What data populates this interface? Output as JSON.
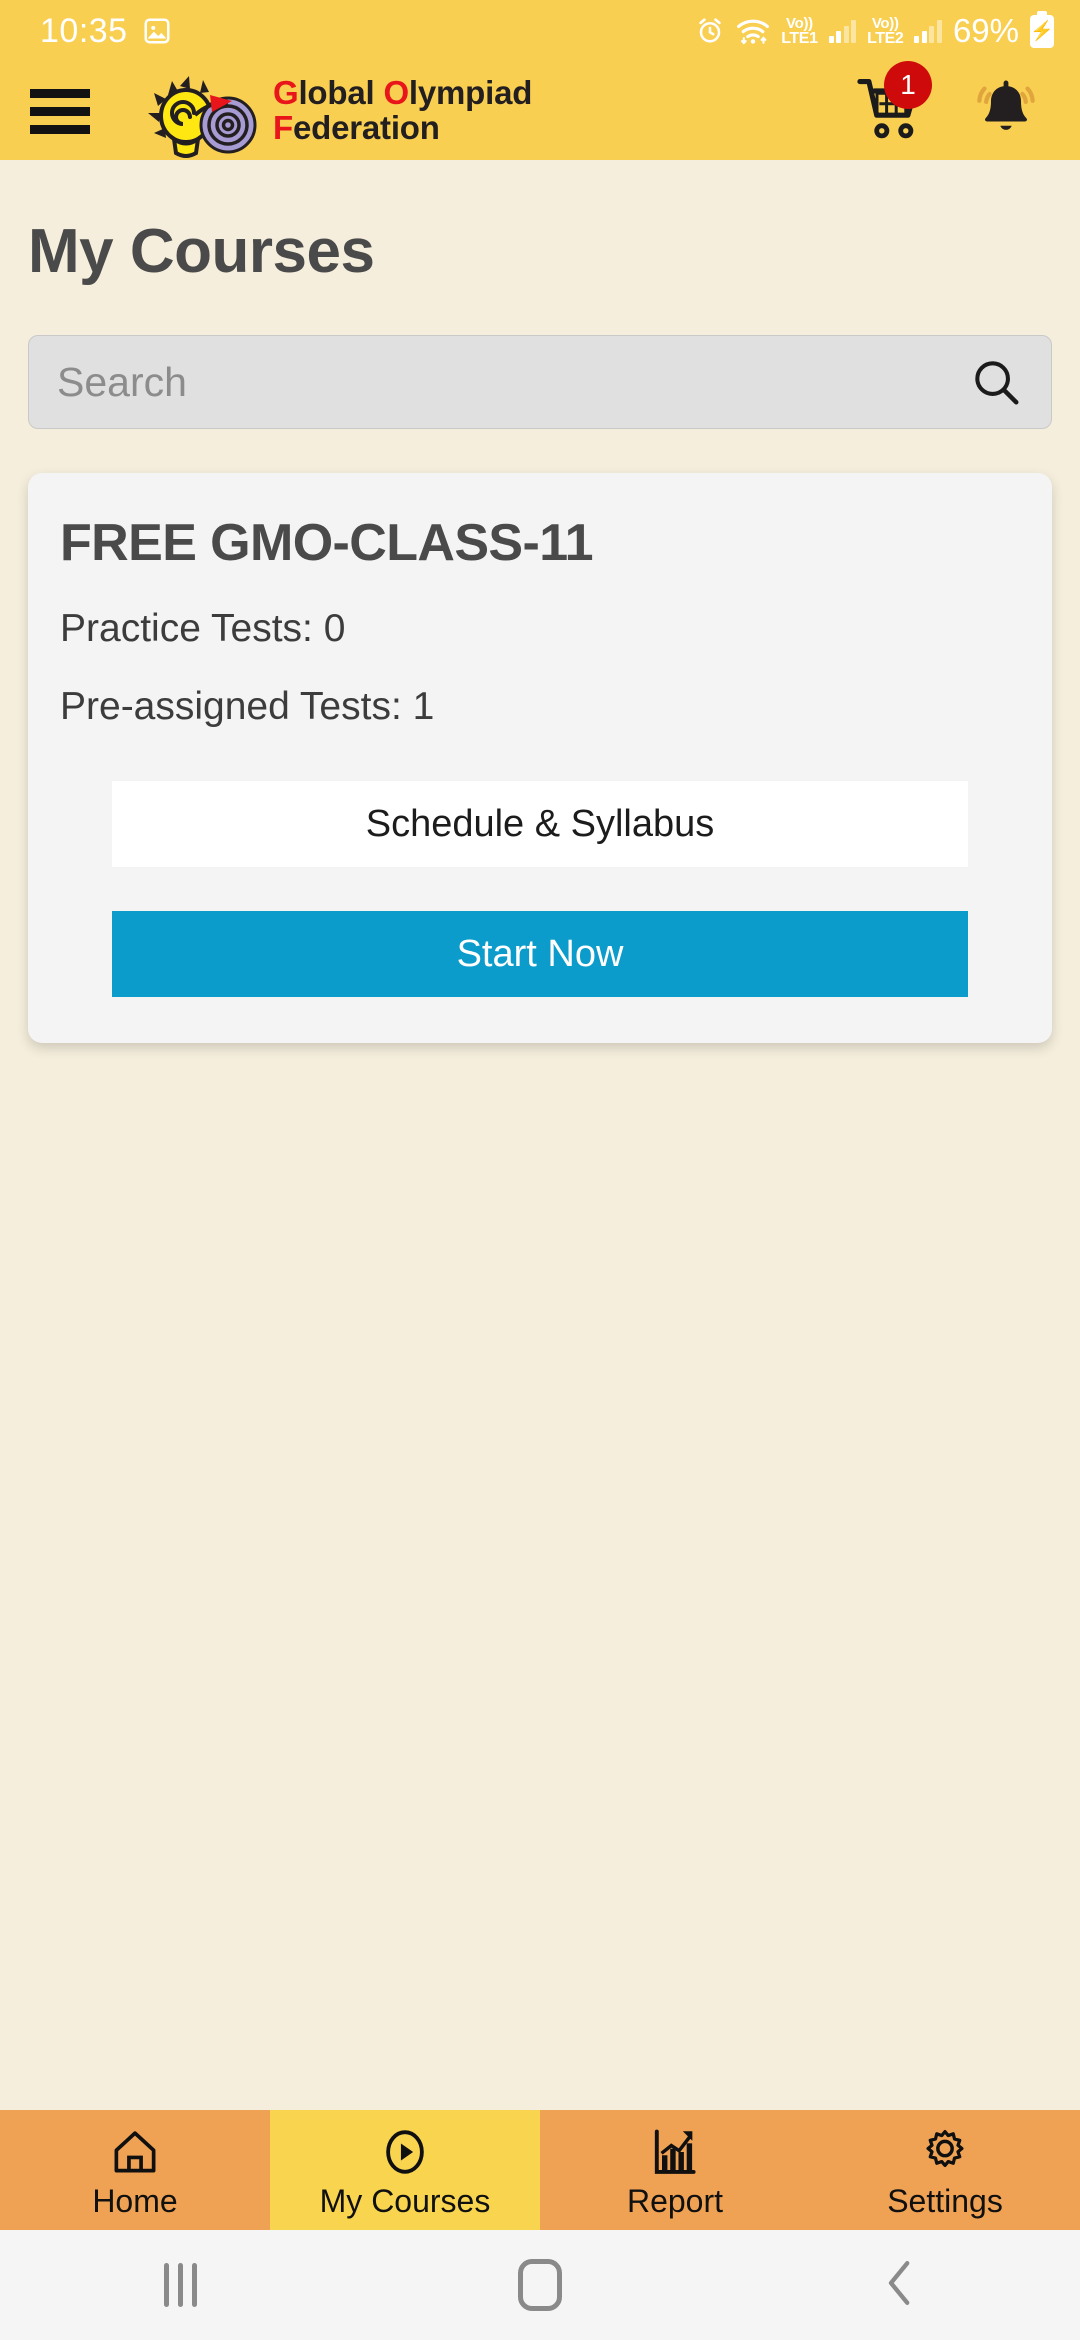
{
  "status_bar": {
    "time": "10:35",
    "icons": [
      "image-icon",
      "alarm-icon",
      "wifi-icon"
    ],
    "sim1_label_top": "Vo))",
    "sim1_label_bottom": "LTE1",
    "sim2_label_top": "Vo))",
    "sim2_label_bottom": "LTE2",
    "battery_percent": "69%",
    "battery_state": "charging"
  },
  "header": {
    "menu_label": "menu",
    "brand_line1_highlight": "G",
    "brand_line1_rest": "lobal ",
    "brand_line1_highlight2": "O",
    "brand_line1_rest2": "lympiad",
    "brand_line2_highlight": "F",
    "brand_line2_rest": "ederation",
    "cart_badge": "1",
    "cart_label": "cart",
    "bell_label": "notifications"
  },
  "main": {
    "page_title": "My Courses",
    "search": {
      "value": "",
      "placeholder": "Search"
    },
    "course_card": {
      "title": "FREE GMO-CLASS-11",
      "practice_tests": "Practice Tests: 0",
      "preassigned_tests": "Pre-assigned Tests: 1",
      "schedule_button": "Schedule & Syllabus",
      "start_button": "Start Now"
    }
  },
  "bottom_nav": {
    "items": [
      {
        "label": "Home",
        "icon": "home-icon",
        "active": false
      },
      {
        "label": "My Courses",
        "icon": "play-icon",
        "active": true
      },
      {
        "label": "Report",
        "icon": "chart-icon",
        "active": false
      },
      {
        "label": "Settings",
        "icon": "gear-icon",
        "active": false
      }
    ]
  },
  "system_nav": {
    "recents": "recents",
    "home": "home",
    "back": "back"
  },
  "colors": {
    "header_yellow": "#F9CF52",
    "page_bg": "#F5EEDC",
    "card_bg": "#F4F4F4",
    "accent_blue": "#0C9CCB",
    "badge_red": "#CE0A0A",
    "brand_red": "#E8161A",
    "nav_orange": "#F0A254",
    "nav_active_yellow": "#F9D44E"
  }
}
